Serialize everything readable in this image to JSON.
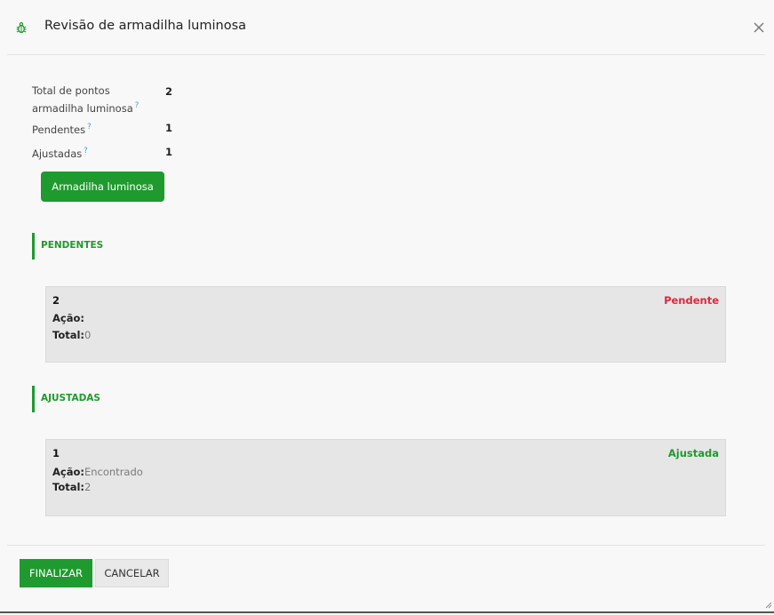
{
  "modal": {
    "title": "Revisão de armadilha luminosa",
    "icon": "bug-icon",
    "close_icon": "close-icon"
  },
  "summary": [
    {
      "label": "Total de pontos armadilha luminosa",
      "help": "?",
      "value": "2"
    },
    {
      "label": "Pendentes",
      "help": "?",
      "value": "1"
    },
    {
      "label": "Ajustadas",
      "help": "?",
      "value": "1"
    }
  ],
  "action_button": "Armadilha luminosa",
  "sections": {
    "pendentes": {
      "title": "PENDENTES",
      "card": {
        "number": "2",
        "status": "Pendente",
        "status_color": "#e0283c",
        "acao_label": "Ação:",
        "acao_value": "",
        "total_label": "Total:",
        "total_value": "0"
      }
    },
    "ajustadas": {
      "title": "AJUSTADAS",
      "card": {
        "number": "1",
        "status": "Ajustada",
        "status_color": "#1f9a2e",
        "acao_label": "Ação:",
        "acao_value": "Encontrado",
        "total_label": "Total:",
        "total_value": "2"
      }
    }
  },
  "footer": {
    "finalizar": "FINALIZAR",
    "cancelar": "CANCELAR"
  },
  "colors": {
    "accent": "#1f9a2e",
    "pending": "#e0283c",
    "help": "#3fa0c8"
  }
}
